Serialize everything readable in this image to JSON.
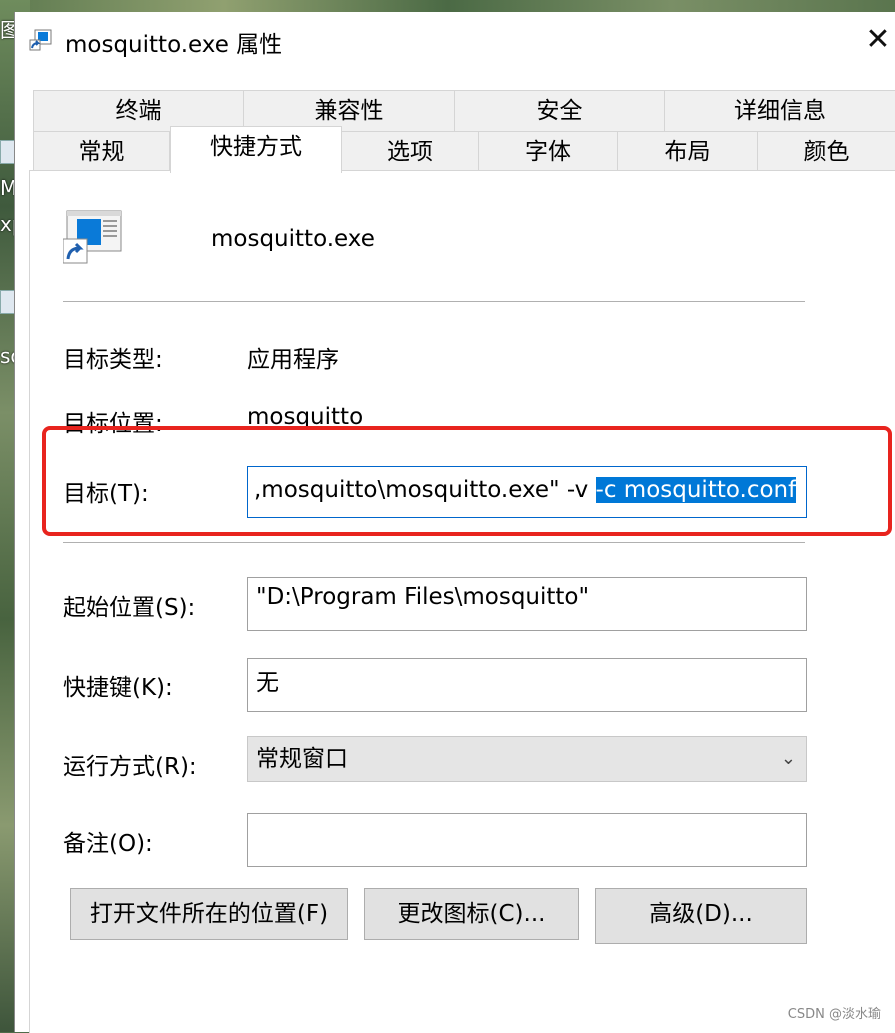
{
  "desktop": {
    "fragments": [
      "图",
      "M",
      "xp",
      "sc"
    ]
  },
  "window": {
    "title": "mosquitto.exe 属性",
    "close_glyph": "✕"
  },
  "tabs_row1": [
    "终端",
    "兼容性",
    "安全",
    "详细信息"
  ],
  "tabs_row2": [
    "常规",
    "快捷方式",
    "选项",
    "字体",
    "布局",
    "颜色"
  ],
  "active_tab": "快捷方式",
  "shortcut": {
    "file_name": "mosquitto.exe",
    "target_type_label": "目标类型:",
    "target_type_value": "应用程序",
    "target_location_label": "目标位置:",
    "target_location_value": "mosquitto",
    "target_label": "目标(T):",
    "target_value_prefix": ",mosquitto\\mosquitto.exe\" -v ",
    "target_value_selected": "-c mosquitto.conf",
    "start_in_label": "起始位置(S):",
    "start_in_value": "\"D:\\Program Files\\mosquitto\"",
    "hotkey_label": "快捷键(K):",
    "hotkey_value": "无",
    "run_label": "运行方式(R):",
    "run_value": "常规窗口",
    "comment_label": "备注(O):",
    "comment_value": ""
  },
  "buttons": {
    "open_location": "打开文件所在的位置(F)",
    "change_icon": "更改图标(C)...",
    "advanced": "高级(D)..."
  },
  "watermark": "CSDN @淡水瑜",
  "colors": {
    "selection": "#0078d7",
    "highlight_border": "#e8241e"
  }
}
